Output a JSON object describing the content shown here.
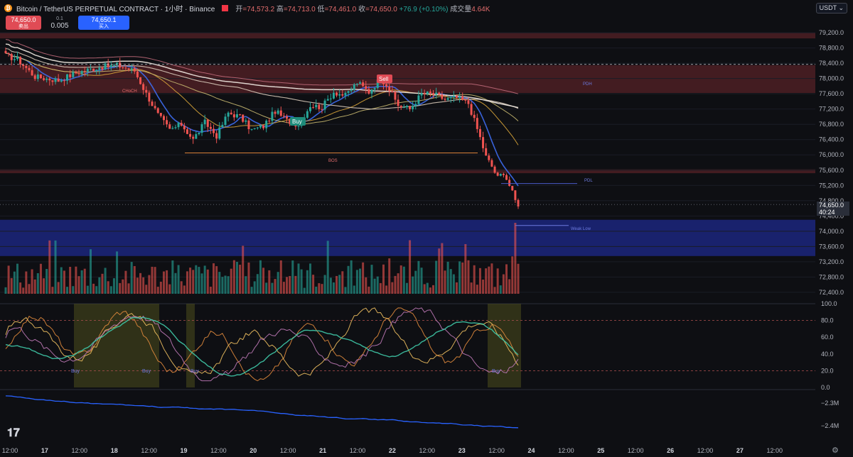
{
  "header": {
    "symbol": "Bitcoin / TetherUS PERPETUAL CONTRACT · 1小时 · Binance",
    "open_label": "开",
    "open": "=74,573.2",
    "high_label": "高",
    "high": "=74,713.0",
    "low_label": "低",
    "low": "=74,461.0",
    "close_label": "收",
    "close": "=74,650.0",
    "change": "+76.9 (+0.10%)",
    "volume_label": "成交量",
    "volume": "4.64K"
  },
  "trade": {
    "sell_price": "74,650.0",
    "sell_label": "卖出",
    "spread_top": "0.1",
    "spread_value": "0.005",
    "buy_price": "74,650.1",
    "buy_label": "买入"
  },
  "currency": "USDT",
  "last_price": {
    "price": "74,650.0",
    "countdown": "40:24"
  },
  "colors": {
    "up": "#26a69a",
    "down": "#ef5350",
    "background": "#0e0f13",
    "demand_zone": "#1e2a8c",
    "supply_zone": "#5a2228"
  },
  "chart_data": {
    "type": "candlestick",
    "price_axis": [
      "79,200.0",
      "78,800.0",
      "78,400.0",
      "78,000.0",
      "77,600.0",
      "77,200.0",
      "76,800.0",
      "76,400.0",
      "76,000.0",
      "75,600.0",
      "75,200.0",
      "74,800.0",
      "74,400.0",
      "74,000.0",
      "73,600.0",
      "73,200.0",
      "72,800.0",
      "72,400.0"
    ],
    "ylim": [
      72250,
      79350
    ],
    "time_axis": [
      "12:00",
      "17",
      "12:00",
      "18",
      "12:00",
      "19",
      "12:00",
      "20",
      "12:00",
      "21",
      "12:00",
      "22",
      "12:00",
      "23",
      "12:00",
      "24",
      "12:00",
      "25",
      "12:00",
      "26",
      "12:00",
      "27",
      "12:00"
    ],
    "bars": 176,
    "last_close": 74650,
    "anchors": [
      [
        0,
        78600
      ],
      [
        4,
        78500
      ],
      [
        10,
        78050
      ],
      [
        18,
        77950
      ],
      [
        24,
        78150
      ],
      [
        32,
        78300
      ],
      [
        38,
        78350
      ],
      [
        44,
        78200
      ],
      [
        48,
        77600
      ],
      [
        52,
        77050
      ],
      [
        56,
        76650
      ],
      [
        60,
        76800
      ],
      [
        64,
        76400
      ],
      [
        68,
        76850
      ],
      [
        72,
        76500
      ],
      [
        76,
        77100
      ],
      [
        80,
        77000
      ],
      [
        84,
        76650
      ],
      [
        88,
        76750
      ],
      [
        92,
        77150
      ],
      [
        96,
        76900
      ],
      [
        100,
        76800
      ],
      [
        104,
        77300
      ],
      [
        108,
        77250
      ],
      [
        112,
        77650
      ],
      [
        116,
        77550
      ],
      [
        120,
        77900
      ],
      [
        124,
        77650
      ],
      [
        128,
        78000
      ],
      [
        130,
        77850
      ],
      [
        134,
        77300
      ],
      [
        138,
        77200
      ],
      [
        142,
        77600
      ],
      [
        146,
        77600
      ],
      [
        150,
        77450
      ],
      [
        154,
        77500
      ],
      [
        158,
        77350
      ],
      [
        160,
        76900
      ],
      [
        162,
        76450
      ],
      [
        164,
        75950
      ],
      [
        166,
        75700
      ],
      [
        168,
        75400
      ],
      [
        170,
        75550
      ],
      [
        172,
        75200
      ],
      [
        174,
        74800
      ],
      [
        175,
        74650
      ]
    ],
    "annotations": [
      {
        "text": "Sell",
        "type": "label"
      },
      {
        "text": "Buy",
        "type": "label"
      },
      {
        "text": "BOS",
        "type": "structure"
      },
      {
        "text": "CHoCH",
        "type": "structure"
      },
      {
        "text": "PDL",
        "type": "level",
        "price": 75250
      },
      {
        "text": "PDH",
        "type": "level",
        "price": 77850
      },
      {
        "text": "Weak Low",
        "type": "level",
        "price": 74150
      }
    ],
    "zones": [
      {
        "kind": "supply",
        "from": 79050,
        "to": 79200
      },
      {
        "kind": "supply",
        "from": 77620,
        "to": 78350
      },
      {
        "kind": "supply",
        "from": 75520,
        "to": 75620
      },
      {
        "kind": "demand",
        "from": 73350,
        "to": 74300
      }
    ],
    "oscillator_axis": [
      "100.0",
      "80.0",
      "60.0",
      "40.0",
      "20.0",
      "0.0"
    ],
    "oscillator_levels": [
      80,
      20
    ],
    "oscillator_labels": [
      "Buy",
      "Buy",
      "Buy",
      "Buy"
    ],
    "lower_axis": [
      "−2.3M",
      "−2.4M"
    ]
  }
}
